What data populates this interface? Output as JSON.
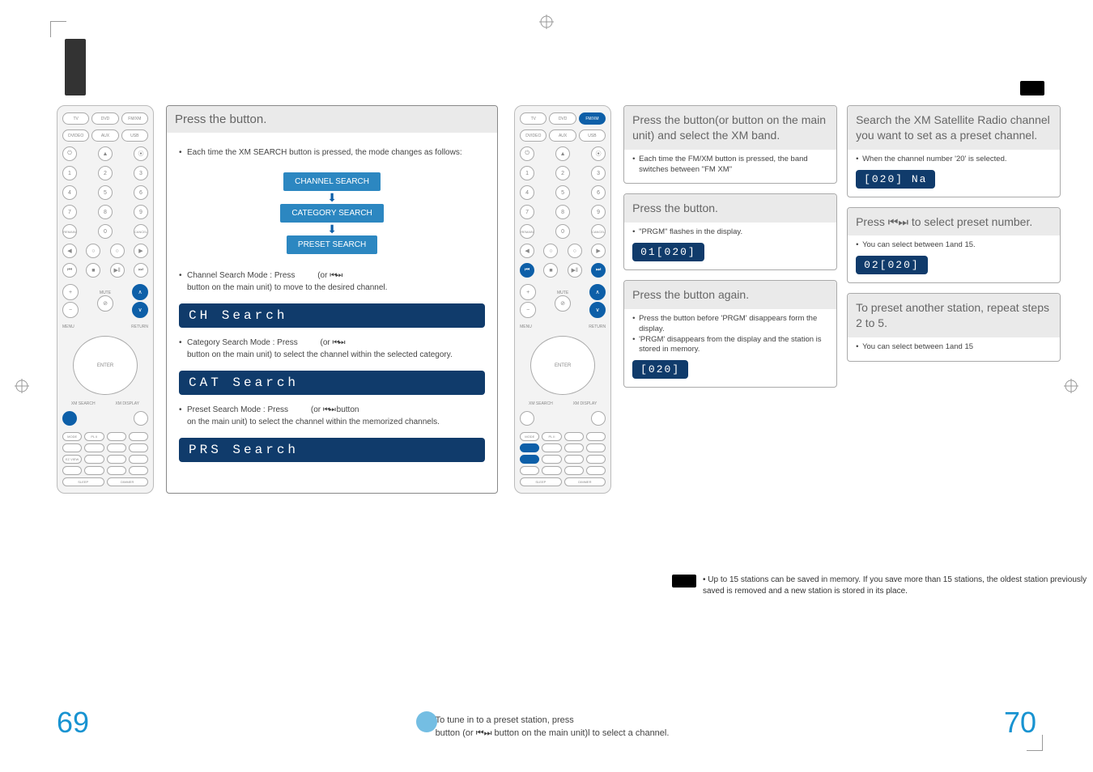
{
  "left": {
    "step_head": "Press the                     button.",
    "mode_note": "Each time the XM SEARCH button is pressed, the mode changes as follows:",
    "modes": [
      "CHANNEL SEARCH",
      "CATEGORY SEARCH",
      "PRESET SEARCH"
    ],
    "ch_line1": "Channel Search Mode : Press",
    "ch_line1_tail": "(or ",
    "ch_line2": "button on the main unit) to move to the desired channel.",
    "ch_display": "CH  Search",
    "cat_line1": "Category Search Mode : Press",
    "cat_line1_tail": "(or ",
    "cat_line2": "button on the main unit) to select the channel within the selected category.",
    "cat_display": "CAT Search",
    "prs_line1": "Preset Search Mode : Press",
    "prs_line1_tail": "(or ",
    "prs_tail2": " button",
    "prs_line2": "on the main unit) to select the channel within the memorized channels.",
    "prs_display": "PRS Search"
  },
  "right": {
    "step1": {
      "head": "Press the           button(or           button on the main unit) and select the XM band.",
      "sub": "Each time the FM/XM button is pressed, the band switches between \"FM   XM\""
    },
    "step2": {
      "head": "Search the XM Satellite Radio channel you want to set as a preset channel.",
      "sub": "When the channel number '20' is selected.",
      "display": "[020]        Na"
    },
    "step3": {
      "head": "Press the                     button.",
      "sub": "\"PRGM\" flashes in the display.",
      "display": "01[020]"
    },
    "step4": {
      "head": "Press ⏮⏭ to select preset number.",
      "sub": "You can select between 1and 15.",
      "display": "02[020]"
    },
    "step5": {
      "head": "Press the                     button again.",
      "sub1": "Press the                     button before 'PRGM' disappears form the display.",
      "sub2": "'PRGM' disappears from the display and the station is stored in memory.",
      "display": "[020]"
    },
    "step6": {
      "head": "To preset another station, repeat steps 2 to 5.",
      "sub": "You can select between 1and 15"
    },
    "note": "Up to 15 stations can be saved in memory. If you save more than 15 stations, the oldest station previously saved is removed and a new station is stored in its place."
  },
  "footer": {
    "tip1": "To tune in to a preset station, press",
    "tip2": "button (or ⏮⏭ button on the main unit)l to select a channel.",
    "left_page": "69",
    "right_page": "70"
  },
  "remote": {
    "row1": [
      "TV",
      "DVD",
      "FM/XM"
    ],
    "row2": [
      "DVIDEO",
      "AUX",
      "USB"
    ]
  },
  "icons": {
    "skip": "⏮⏭"
  }
}
